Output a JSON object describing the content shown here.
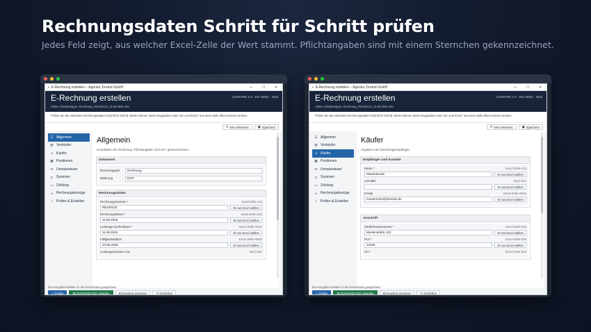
{
  "hero": {
    "title": "Rechnungsdaten Schritt für Schritt prüfen",
    "subtitle": "Jedes Feld zeigt, aus welcher Excel-Zelle der Wert stammt. Pflichtangaben sind mit einem Sternchen gekennzeichnet."
  },
  "window": {
    "title": "E-Rechnung erstellen – Agentur Zentral GmbH",
    "min": "—",
    "max": "☐",
    "close": "✕",
    "header_title": "E-Rechnung erstellen",
    "header_sub": "Aktive Arbeitsmappe: Rechnung_RE100123_11.08.2026.xlsx",
    "header_right": "ZUGFeRD 2.3 · EN 16931 · lokal",
    "intro": "Prüfen Sie die erkannten Rechnungsdaten Schritt für Schritt. Werte können direkt eingegeben oder mit „Aus Excel\" aus einer Zelle übernommen werden.",
    "btn_refresh": "Neu erkennen",
    "btn_save": "Speichern",
    "nav": [
      "Allgemein",
      "Verkäufer",
      "Käufer",
      "Positionen",
      "Umsatzsteuer",
      "Summen",
      "Zahlung",
      "Rechnungsbezüge",
      "Prüfen & Erstellen"
    ],
    "status": "Ihre Eingaben bleiben in der Excel-Datei gespeichert.",
    "foot": {
      "check": "Prüfen",
      "pdf": "ZUGFeRD-PDF erstellen",
      "result": "Ergebnis anzeigen",
      "close": "Schließen"
    },
    "excel_btn": "Aus Excel wählen"
  },
  "left": {
    "title": "Allgemein",
    "subtitle": "Grunddaten der Rechnung. Pflichtangaben sind mit * gekennzeichnet.",
    "doc_group": "Dokument",
    "doc_fields": [
      {
        "label": "Rechnungsart",
        "value": "Rechnung"
      },
      {
        "label": "Währung",
        "value": "EUR"
      }
    ],
    "data_group": "Rechnungsdaten",
    "fields": [
      {
        "label": "Rechnungsnummer *",
        "src": "Excel Zelle L22",
        "value": "RE100123"
      },
      {
        "label": "Rechnungsdatum *",
        "src": "Excel Zelle U22",
        "value": "11.08.2026"
      },
      {
        "label": "Leistungs-/Lieferdatum *",
        "src": "Excel Zelle AD22",
        "value": "11.08.2026"
      },
      {
        "label": "Fälligkeitsdatum",
        "src": "Excel Zelle AM22",
        "value": "10.09.2026"
      },
      {
        "label": "Leistungszeitraum von",
        "src": "Noch leer",
        "value": ""
      }
    ]
  },
  "right": {
    "title": "Käufer",
    "subtitle": "Angaben zum Rechnungsempfänger.",
    "g1": "Empfänger und Kontakt",
    "g1_fields": [
      {
        "label": "Name *",
        "src": "Excel Zelle E13",
        "value": "Musterkunde"
      },
      {
        "label": "USt-IdNr.",
        "src": "Noch leer",
        "value": ""
      },
      {
        "label": "E-Mail",
        "src": "Excel Zelle AD16",
        "value": "mustermann@domain.de"
      }
    ],
    "g2": "Anschrift",
    "g2_fields": [
      {
        "label": "Straße/Hausnummer *",
        "src": "Excel Zelle E14",
        "value": "Musterstraße 123"
      },
      {
        "label": "PLZ *",
        "src": "Excel Zelle E15",
        "value": "12345"
      },
      {
        "label": "Ort *",
        "src": "Excel Zelle E15",
        "value": ""
      }
    ]
  },
  "colors": {
    "accent": "#2465a8",
    "header": "#17243a",
    "green": "#1f7a4a"
  }
}
